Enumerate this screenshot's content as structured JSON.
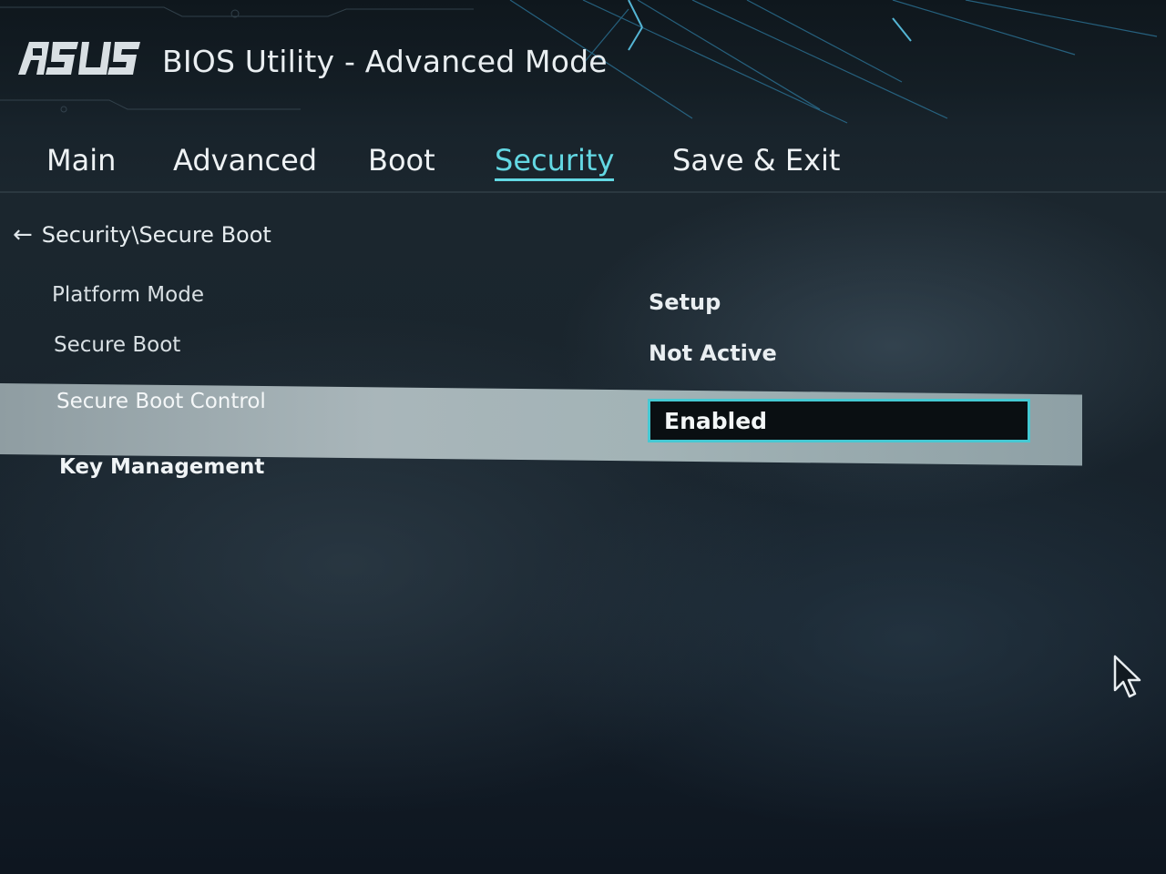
{
  "header": {
    "logo_text": "ASUS",
    "title": "BIOS Utility - Advanced Mode"
  },
  "tabs": [
    {
      "label": "Main",
      "active": false
    },
    {
      "label": "Advanced",
      "active": false
    },
    {
      "label": "Boot",
      "active": false
    },
    {
      "label": "Security",
      "active": true
    },
    {
      "label": "Save & Exit",
      "active": false
    }
  ],
  "breadcrumb": {
    "back_icon": "arrow-left-icon",
    "path": "Security\\Secure Boot"
  },
  "settings": [
    {
      "label": "Platform Mode",
      "value": "Setup"
    },
    {
      "label": "Secure Boot",
      "value": "Not Active"
    },
    {
      "label": "Secure Boot Control",
      "value": "Enabled",
      "selected": true
    },
    {
      "label": "Key Management"
    }
  ],
  "colors": {
    "accent": "#63d8e3",
    "select_border": "#45c9d3",
    "highlight_row": "#a9b6ba"
  },
  "icons": {
    "pointer": "mouse-pointer-icon"
  }
}
